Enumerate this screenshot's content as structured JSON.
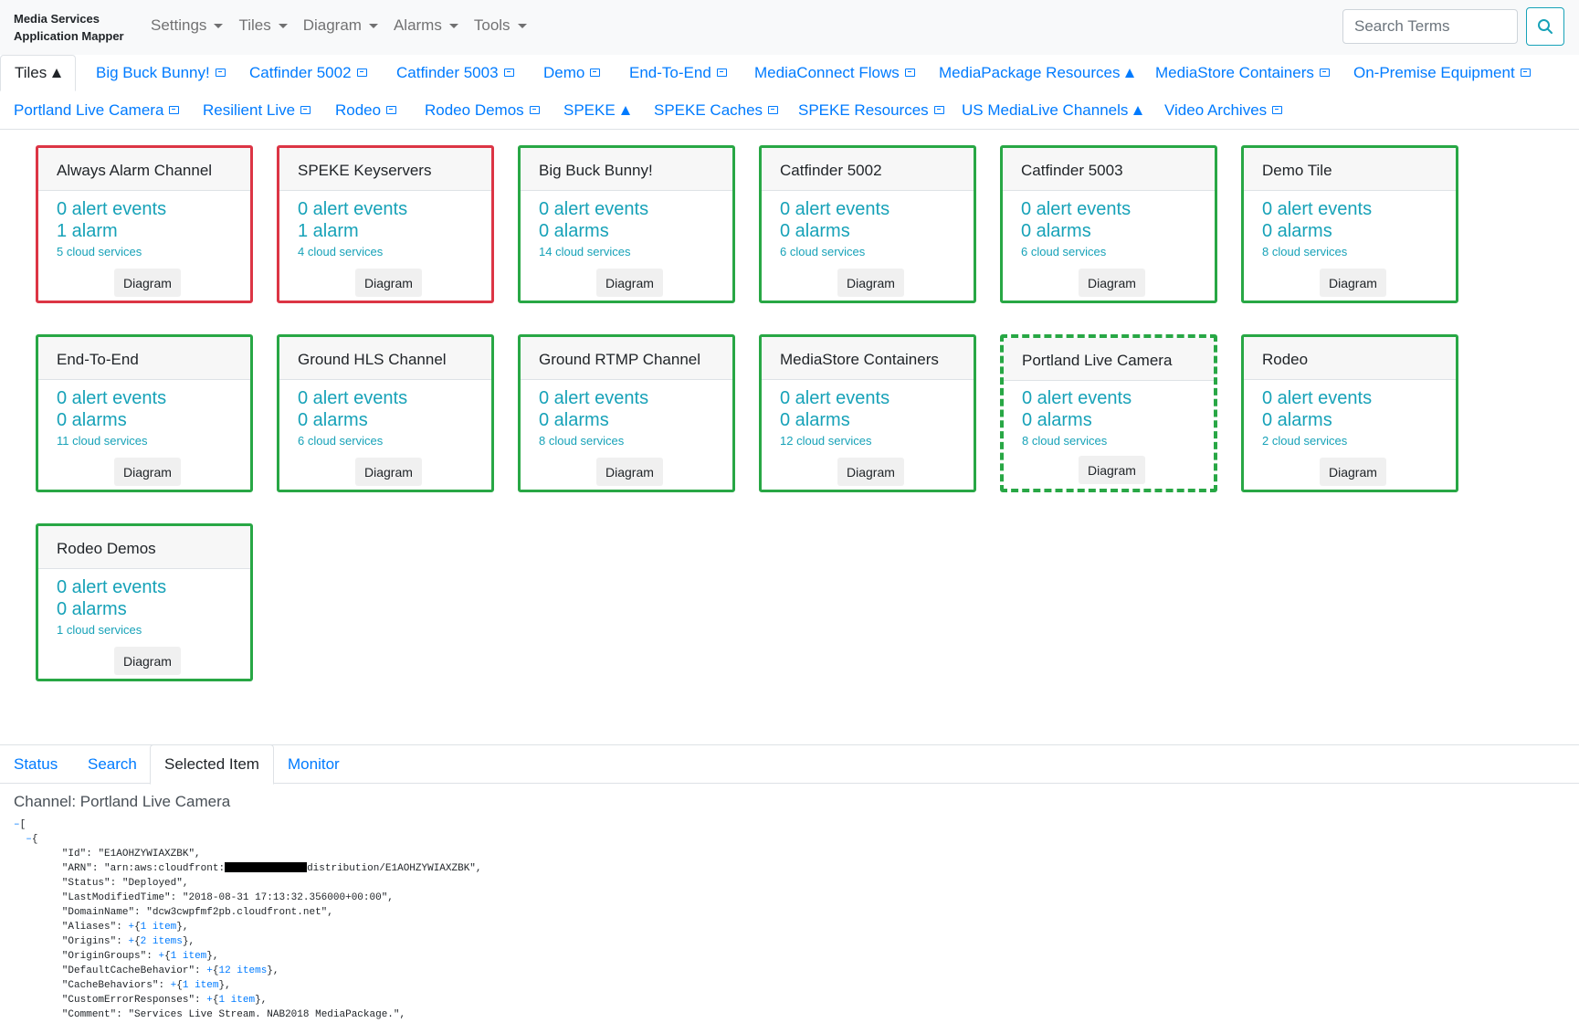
{
  "app": {
    "brand": "Media Services Application Mapper",
    "menus": [
      "Settings",
      "Tiles",
      "Diagram",
      "Alarms",
      "Tools"
    ],
    "search_placeholder": "Search Terms"
  },
  "tabs": [
    {
      "label": "Tiles",
      "icon": "warning-triangle-icon"
    },
    {
      "label": "Big Buck Bunny!",
      "icon": "diagram-icon"
    },
    {
      "label": "Catfinder 5002",
      "icon": "diagram-icon"
    },
    {
      "label": "Catfinder 5003",
      "icon": "diagram-icon"
    },
    {
      "label": "Demo",
      "icon": "diagram-icon"
    },
    {
      "label": "End-To-End",
      "icon": "diagram-icon"
    },
    {
      "label": "MediaConnect Flows",
      "icon": "diagram-icon"
    },
    {
      "label": "MediaPackage Resources",
      "icon": "warning-triangle-icon"
    },
    {
      "label": "MediaStore Containers",
      "icon": "diagram-icon"
    },
    {
      "label": "On-Premise Equipment",
      "icon": "diagram-icon"
    },
    {
      "label": "Portland Live Camera",
      "icon": "diagram-icon"
    },
    {
      "label": "Resilient Live",
      "icon": "diagram-icon"
    },
    {
      "label": "Rodeo",
      "icon": "diagram-icon"
    },
    {
      "label": "Rodeo Demos",
      "icon": "diagram-icon"
    },
    {
      "label": "SPEKE",
      "icon": "warning-triangle-icon"
    },
    {
      "label": "SPEKE Caches",
      "icon": "diagram-icon"
    },
    {
      "label": "SPEKE Resources",
      "icon": "diagram-icon"
    },
    {
      "label": "US MediaLive Channels",
      "icon": "warning-triangle-icon"
    },
    {
      "label": "Video Archives",
      "icon": "diagram-icon"
    }
  ],
  "tiles": [
    {
      "name": "Always Alarm Channel",
      "events": "0 alert events",
      "alarms": "1 alarm",
      "services": "5 cloud services",
      "button": "Diagram",
      "state": "alarm"
    },
    {
      "name": "SPEKE Keyservers",
      "events": "0 alert events",
      "alarms": "1 alarm",
      "services": "4 cloud services",
      "button": "Diagram",
      "state": "alarm"
    },
    {
      "name": "Big Buck Bunny!",
      "events": "0 alert events",
      "alarms": "0 alarms",
      "services": "14 cloud services",
      "button": "Diagram",
      "state": "ok"
    },
    {
      "name": "Catfinder 5002",
      "events": "0 alert events",
      "alarms": "0 alarms",
      "services": "6 cloud services",
      "button": "Diagram",
      "state": "ok"
    },
    {
      "name": "Catfinder 5003",
      "events": "0 alert events",
      "alarms": "0 alarms",
      "services": "6 cloud services",
      "button": "Diagram",
      "state": "ok"
    },
    {
      "name": "Demo Tile",
      "events": "0 alert events",
      "alarms": "0 alarms",
      "services": "8 cloud services",
      "button": "Diagram",
      "state": "ok"
    },
    {
      "name": "End-To-End",
      "events": "0 alert events",
      "alarms": "0 alarms",
      "services": "11 cloud services",
      "button": "Diagram",
      "state": "ok"
    },
    {
      "name": "Ground HLS Channel",
      "events": "0 alert events",
      "alarms": "0 alarms",
      "services": "6 cloud services",
      "button": "Diagram",
      "state": "ok"
    },
    {
      "name": "Ground RTMP Channel",
      "events": "0 alert events",
      "alarms": "0 alarms",
      "services": "8 cloud services",
      "button": "Diagram",
      "state": "ok"
    },
    {
      "name": "MediaStore Containers",
      "events": "0 alert events",
      "alarms": "0 alarms",
      "services": "12 cloud services",
      "button": "Diagram",
      "state": "ok"
    },
    {
      "name": "Portland Live Camera",
      "events": "0 alert events",
      "alarms": "0 alarms",
      "services": "8 cloud services",
      "button": "Diagram",
      "state": "selected"
    },
    {
      "name": "Rodeo",
      "events": "0 alert events",
      "alarms": "0 alarms",
      "services": "2 cloud services",
      "button": "Diagram",
      "state": "ok"
    },
    {
      "name": "Rodeo Demos",
      "events": "0 alert events",
      "alarms": "0 alarms",
      "services": "1 cloud services",
      "button": "Diagram",
      "state": "ok"
    }
  ],
  "bottom_tabs": [
    "Status",
    "Search",
    "Selected Item",
    "Monitor"
  ],
  "selected": {
    "title": "Channel: Portland Live Camera",
    "json_open": "[",
    "obj_open": "{",
    "lines": [
      {
        "key": "Id",
        "value": "\"E1AOHZYWIAXZBK\","
      },
      {
        "key": "ARN",
        "value_prefix": "\"arn:aws:cloudfront:",
        "value_suffix": "distribution/E1AOHZYWIAXZBK\","
      },
      {
        "key": "Status",
        "value": "\"Deployed\","
      },
      {
        "key": "LastModifiedTime",
        "value": "\"2018-08-31 17:13:32.356000+00:00\","
      },
      {
        "key": "DomainName",
        "value": "\"dcw3cwpfmf2pb.cloudfront.net\","
      },
      {
        "key": "Aliases",
        "collapsed": "1 item"
      },
      {
        "key": "Origins",
        "collapsed": "2 items"
      },
      {
        "key": "OriginGroups",
        "collapsed": "1 item"
      },
      {
        "key": "DefaultCacheBehavior",
        "collapsed": "12 items"
      },
      {
        "key": "CacheBehaviors",
        "collapsed": "1 item"
      },
      {
        "key": "CustomErrorResponses",
        "collapsed": "1 item"
      },
      {
        "key": "Comment",
        "value": "\"Services Live Stream. NAB2018 MediaPackage.\","
      }
    ]
  }
}
